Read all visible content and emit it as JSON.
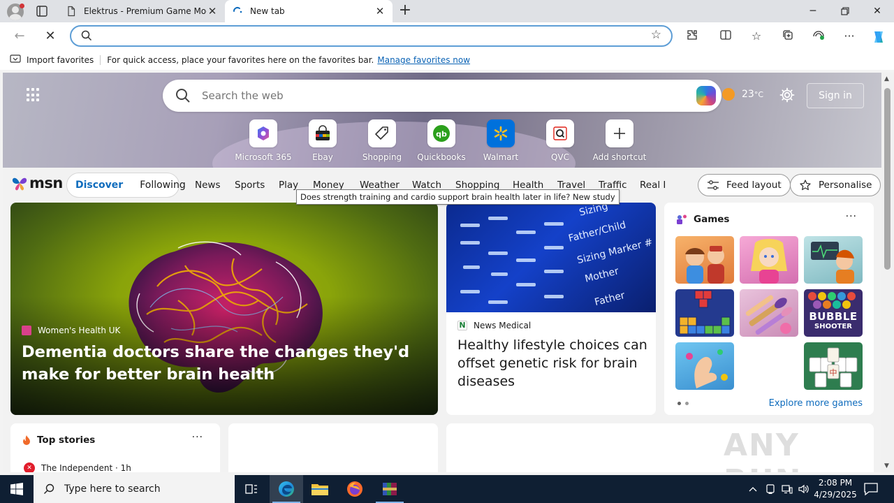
{
  "browser": {
    "tabs": [
      {
        "title": "Elektrus - Premium Game Mods |"
      },
      {
        "title": "New tab"
      }
    ],
    "address_value": "",
    "favorites_bar": {
      "import_label": "Import favorites",
      "message": "For quick access, place your favorites here on the favorites bar.",
      "manage_link": "Manage favorites now"
    }
  },
  "newtab": {
    "search_placeholder": "Search the web",
    "weather": {
      "temp": "23",
      "unit": "°C"
    },
    "sign_in": "Sign in",
    "shortcuts": [
      {
        "label": "Microsoft 365",
        "icon": "microsoft-365-icon"
      },
      {
        "label": "Ebay",
        "icon": "ebay-bag-icon"
      },
      {
        "label": "Shopping",
        "icon": "shopping-tag-icon"
      },
      {
        "label": "Quickbooks",
        "icon": "quickbooks-icon"
      },
      {
        "label": "Walmart",
        "icon": "walmart-icon"
      },
      {
        "label": "QVC",
        "icon": "qvc-icon"
      },
      {
        "label": "Add shortcut",
        "icon": "plus-icon"
      }
    ]
  },
  "msn": {
    "logo_text": "msn",
    "pills": [
      "Discover",
      "Following"
    ],
    "nav": [
      "News",
      "Sports",
      "Play",
      "Money",
      "Weather",
      "Watch",
      "Shopping",
      "Health",
      "Travel",
      "Traffic",
      "Real E"
    ],
    "feed_layout": "Feed layout",
    "personalise": "Personalise",
    "tooltip": "Does strength training and cardio support brain health later in life? New study"
  },
  "cards": {
    "hero": {
      "source": "Women's Health UK",
      "headline": "Dementia doctors share the changes they'd make for better brain health"
    },
    "second": {
      "source": "News Medical",
      "headline": "Healthy lifestyle choices can offset genetic risk for brain diseases",
      "image_labels": [
        "Sizing",
        "Father/Child",
        "Sizing Marker #",
        "Mother",
        "Father"
      ]
    },
    "games": {
      "title": "Games",
      "more": "···",
      "explore": "Explore more games",
      "bubble_title": "BUBBLE",
      "bubble_sub": "SHOOTER"
    },
    "top_stories": {
      "title": "Top stories",
      "more": "···",
      "source": "The Independent · 1h"
    }
  },
  "watermark": "ANY RUN",
  "taskbar": {
    "search_placeholder": "Type here to search",
    "time": "2:08 PM",
    "date": "4/29/2025"
  },
  "colors": {
    "accent": "#0f6cbd",
    "taskbar": "#0f1f33",
    "omnibox_focus": "#5e9ed6"
  }
}
